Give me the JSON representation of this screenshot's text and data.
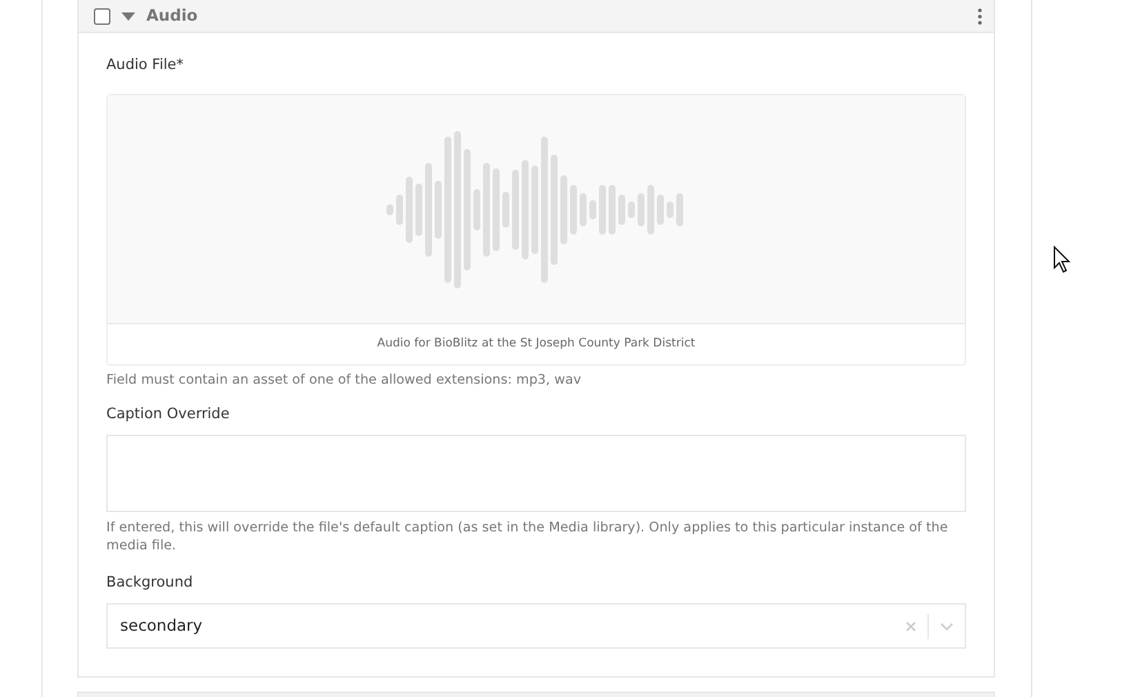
{
  "block": {
    "title": "Audio",
    "checked": false,
    "expanded": true
  },
  "fields": [
    {
      "kind": "media",
      "label": "Audio File*",
      "caption": "Audio for BioBlitz at the St Joseph County Park District",
      "help": "Field must contain an asset of one of the allowed extensions: mp3, wav"
    },
    {
      "kind": "textarea",
      "label": "Caption Override",
      "help": "If entered, this will override the file's default caption (as set in the Media library). Only applies to this particular instance of the media file."
    },
    {
      "kind": "select",
      "label": "Background",
      "value": "secondary"
    }
  ]
}
